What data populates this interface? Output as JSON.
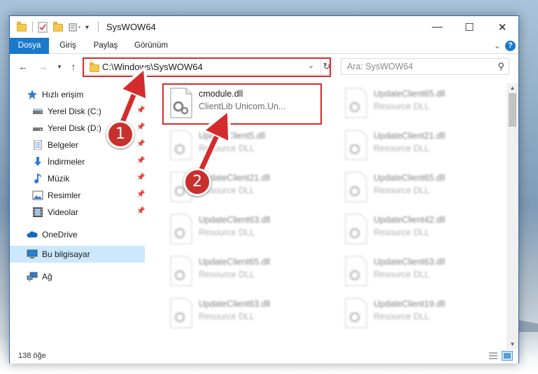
{
  "window": {
    "title": "SysWOW64",
    "controls": {
      "minimize": "—",
      "maximize": "☐",
      "close": "✕"
    }
  },
  "ribbon": {
    "tabs": [
      "Dosya",
      "Giriş",
      "Paylaş",
      "Görünüm"
    ],
    "help": "?"
  },
  "address": {
    "path": "C:\\Windows\\SysWOW64",
    "search_placeholder": "Ara: SysWOW64"
  },
  "sidebar": {
    "items": [
      {
        "label": "Hızlı erişim",
        "icon": "star-icon"
      },
      {
        "label": "Yerel Disk (C:)",
        "icon": "drive-icon",
        "pinned": true
      },
      {
        "label": "Yerel Disk (D:)",
        "icon": "drive-icon",
        "pinned": true
      },
      {
        "label": "Belgeler",
        "icon": "document-icon",
        "pinned": true
      },
      {
        "label": "İndirmeler",
        "icon": "download-icon",
        "pinned": true
      },
      {
        "label": "Müzik",
        "icon": "music-icon",
        "pinned": true
      },
      {
        "label": "Resimler",
        "icon": "pictures-icon",
        "pinned": true
      },
      {
        "label": "Videolar",
        "icon": "video-icon",
        "pinned": true
      },
      {
        "label": "OneDrive",
        "icon": "cloud-icon"
      },
      {
        "label": "Bu bilgisayar",
        "icon": "computer-icon",
        "selected": true
      },
      {
        "label": "Ağ",
        "icon": "network-icon"
      }
    ]
  },
  "files": {
    "highlighted": {
      "name": "cmodule.dll",
      "desc": "ClientLib Unicom.Un..."
    },
    "others": [
      {
        "name": "UpdateClient65.dll",
        "desc": "Resource DLL"
      },
      {
        "name": "UpdateClient5.dll",
        "desc": "Resource DLL"
      },
      {
        "name": "UpdateClient21.dll",
        "desc": "Resource DLL"
      },
      {
        "name": "UpdateClient21.dll",
        "desc": "Resource DLL"
      },
      {
        "name": "UpdateClient65.dll",
        "desc": "Resource DLL"
      },
      {
        "name": "UpdateClient63.dll",
        "desc": "Resource DLL"
      },
      {
        "name": "UpdateClient42.dll",
        "desc": "Resource DLL"
      },
      {
        "name": "UpdateClient65.dll",
        "desc": "Resource DLL"
      },
      {
        "name": "UpdateClient63.dll",
        "desc": "Resource DLL"
      },
      {
        "name": "UpdateClient63.dll",
        "desc": "Resource DLL"
      },
      {
        "name": "UpdateClient19.dll",
        "desc": "Resource DLL"
      }
    ]
  },
  "status": {
    "count": "138 öğe"
  },
  "annotations": {
    "step1": "1",
    "step2": "2",
    "color": "#d42c2c"
  }
}
